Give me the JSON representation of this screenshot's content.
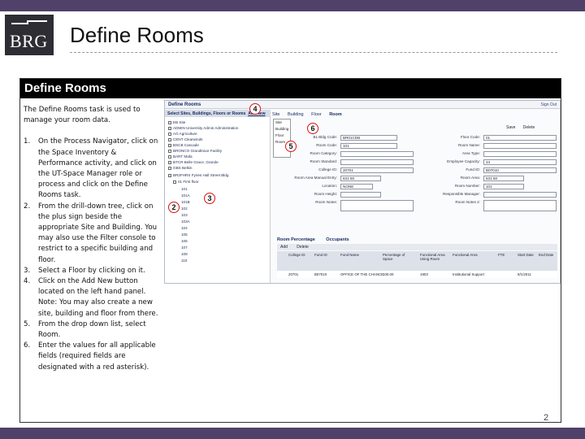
{
  "logo": {
    "text": "BRG"
  },
  "slide": {
    "title": "Define Rooms",
    "section_heading": "Define Rooms",
    "page_number": "2"
  },
  "instructions": {
    "intro": "The Define Rooms task is used to manage your room data.",
    "steps": [
      {
        "num": "1.",
        "text": "On the Process Navigator, click on the Space Inventory & Performance activity, and click on the UT-Space Manager role or process and click on the Define Rooms task."
      },
      {
        "num": "2.",
        "text": "From the drill-down tree, click on the plus sign beside the appropriate Site and Building. You may also use the Filter console to restrict to a specific building and floor."
      },
      {
        "num": "3.",
        "text": "Select a Floor by clicking on it."
      },
      {
        "num": "4.",
        "text": "Click on the Add New button located on the left hand panel. Note: You may also create a new site, building and floor from there."
      },
      {
        "num": "5.",
        "text": "From the drop down list, select Room."
      },
      {
        "num": "6.",
        "text": "Enter the values for all applicable fields (required fields are designated with a red asterisk)."
      }
    ]
  },
  "app": {
    "title": "Define Rooms",
    "signout": "Sign Out",
    "tree_tab": "Select Sites, Buildings, Floors or Rooms",
    "tree_add": "Add New",
    "tree_items": [
      "EB Site",
      "ADMIN University Admin Administration",
      "AG Agriculture",
      "CENT Clearwinds",
      "BSCB Cascade",
      "BRONCO Grandtrace Facility",
      "BART Mafa",
      "BTCR Belle Grace, Grande",
      "GBS Belkin",
      "BR2FHRS Fynes Hall Street Bldg",
      "01 First floor"
    ],
    "rooms": [
      "101",
      "101A",
      "101B",
      "102",
      "103",
      "103A",
      "104",
      "105",
      "106",
      "107",
      "108",
      "110"
    ],
    "tabs": [
      "Site",
      "Building",
      "Floor",
      "Room"
    ],
    "menu_items": [
      "Site",
      "Building",
      "Floor",
      "Room"
    ],
    "save": "Save",
    "delete": "Delete",
    "form_left": [
      {
        "label": "BL Bldg Code:",
        "value": "BR01CDB"
      },
      {
        "label": "Room Code:",
        "value": "101"
      },
      {
        "label": "Room Category:",
        "value": ""
      },
      {
        "label": "Room Standard:",
        "value": ""
      },
      {
        "label": "College ID:",
        "value": "20701"
      },
      {
        "label": "Room Area Manual Entry:",
        "value": "631.50"
      },
      {
        "label": "Location:",
        "value": "NONE"
      },
      {
        "label": "Room Height:",
        "value": ""
      },
      {
        "label": "Room Notes:",
        "value": ""
      }
    ],
    "form_right": [
      {
        "label": "Floor Code:",
        "value": "01"
      },
      {
        "label": "Room Name:",
        "value": ""
      },
      {
        "label": "Area Type:",
        "value": ""
      },
      {
        "label": "Employee Capacity:",
        "value": "24"
      },
      {
        "label": "Fund ID:",
        "value": "B07010"
      },
      {
        "label": "Room Area:",
        "value": "631.50"
      },
      {
        "label": "Room Number:",
        "value": "101"
      },
      {
        "label": "Responsible Manager:",
        "value": ""
      },
      {
        "label": "Room Notes 2:",
        "value": ""
      }
    ],
    "subtabs": [
      "Room Percentage",
      "Occupants"
    ],
    "grid_actions": [
      "Add",
      "Delete"
    ],
    "grid_headers": [
      "College ID",
      "Fund ID",
      "Fund Name",
      "Percentage of Space",
      "Functional Area Using Room",
      "Functional Area",
      "FTE",
      "Start Date",
      "End Date"
    ],
    "grid_row": [
      "20701",
      "B07010",
      "OFFICE OF THE CHANCE",
      "100.00",
      "1903",
      "Institutional Support",
      "",
      "8/1/2011",
      ""
    ]
  },
  "callouts": [
    "2",
    "3",
    "4",
    "5",
    "6"
  ]
}
